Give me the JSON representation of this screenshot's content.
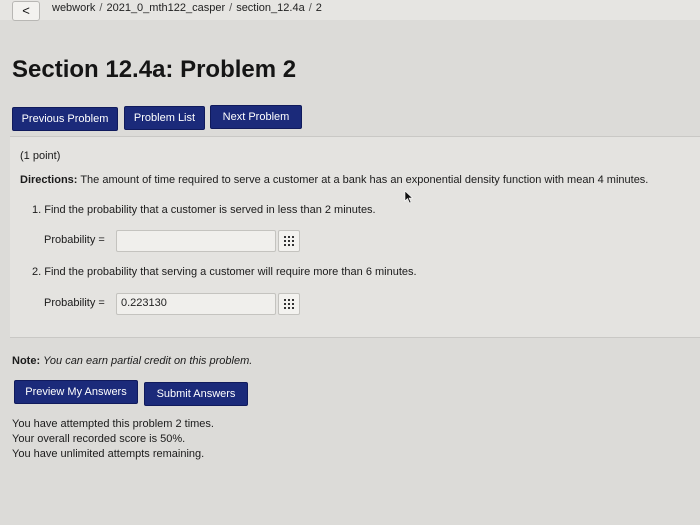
{
  "breadcrumb": {
    "back": "<",
    "items": [
      "webwork",
      "2021_0_mth122_casper",
      "section_12.4a",
      "2"
    ]
  },
  "title": "Section 12.4a: Problem 2",
  "nav": {
    "previous": "Previous Problem",
    "list": "Problem List",
    "next": "Next Problem"
  },
  "problem": {
    "points": "(1 point)",
    "directions_label": "Directions:",
    "directions_text": "The amount of time required to serve a customer at a bank has an exponential density function with mean 4 minutes.",
    "q1": "1. Find the probability that a customer is served in less than 2 minutes.",
    "q1_label": "Probability =",
    "q1_value": "",
    "q2": "2. Find the probability that serving a customer will require more than 6 minutes.",
    "q2_label": "Probability =",
    "q2_value": "0.223130"
  },
  "note": {
    "label": "Note:",
    "text": "You can earn partial credit on this problem."
  },
  "actions": {
    "preview": "Preview My Answers",
    "submit": "Submit Answers"
  },
  "status": {
    "line1": "You have attempted this problem 2 times.",
    "line2": "Your overall recorded score is 50%.",
    "line3": "You have unlimited attempts remaining."
  },
  "colors": {
    "button": "#1b2a7a",
    "background": "#dcdbd8"
  }
}
